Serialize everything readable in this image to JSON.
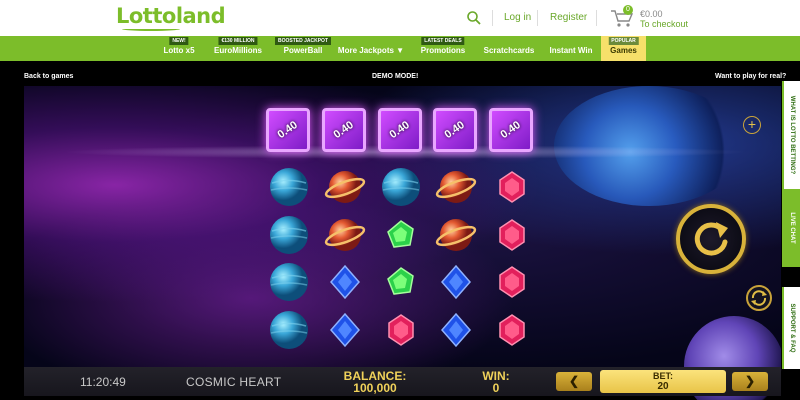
{
  "header": {
    "logo": "Lottoland",
    "login": "Log in",
    "register": "Register",
    "cart_count": "0",
    "cart_amount": "€0.00",
    "checkout": "To checkout"
  },
  "nav": {
    "items": [
      {
        "label": "Lotto x5",
        "badge": "NEW!"
      },
      {
        "label": "EuroMillions",
        "badge": "€130 MILLION"
      },
      {
        "label": "PowerBall",
        "badge": "BOOSTED JACKPOT"
      },
      {
        "label": "More Jackpots ▼",
        "badge": ""
      },
      {
        "label": "Promotions",
        "badge": "LATEST DEALS"
      },
      {
        "label": "Scratchcards",
        "badge": ""
      },
      {
        "label": "Instant Win",
        "badge": ""
      },
      {
        "label": "Games",
        "badge": "POPULAR"
      }
    ]
  },
  "game": {
    "back": "Back to games",
    "mode": "DEMO MODE!",
    "play_real": "Want to play for real?",
    "crate_label": "0.40",
    "side_tabs": [
      "WHAT IS LOTTO BETTING?",
      "LIVE CHAT",
      "SUPPORT & FAQ"
    ],
    "reels": [
      [
        "blue-planet",
        "fire-planet",
        "blue-planet",
        "fire-planet",
        "red-gem"
      ],
      [
        "blue-planet",
        "fire-planet",
        "green-gem",
        "fire-planet",
        "red-gem"
      ],
      [
        "blue-planet",
        "blue-gem",
        "green-gem",
        "blue-gem",
        "red-gem"
      ],
      [
        "blue-planet",
        "blue-gem",
        "red-gem",
        "blue-gem",
        "red-gem"
      ]
    ]
  },
  "status": {
    "clock": "11:20:49",
    "game_name": "COSMIC HEART",
    "balance_label": "BALANCE:",
    "balance_value": "100,000",
    "win_label": "WIN:",
    "win_value": "0",
    "bet_label": "BET:",
    "bet_value": "20",
    "bet_down": "❮",
    "bet_up": "❯"
  },
  "colors": {
    "brand_green": "#7cbd2a",
    "gold": "#d8b23a",
    "active_tab": "#f6e06a"
  }
}
